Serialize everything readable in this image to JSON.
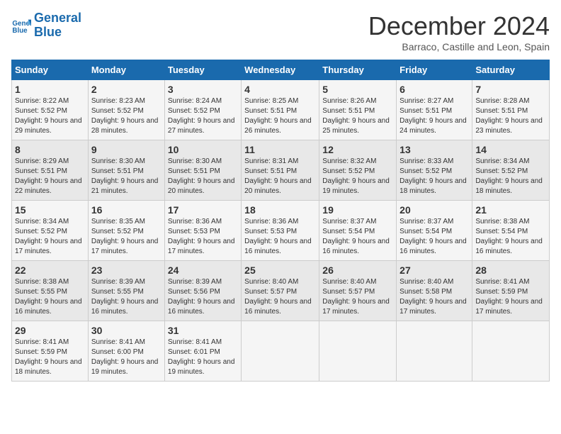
{
  "logo": {
    "line1": "General",
    "line2": "Blue"
  },
  "title": "December 2024",
  "subtitle": "Barraco, Castille and Leon, Spain",
  "days_of_week": [
    "Sunday",
    "Monday",
    "Tuesday",
    "Wednesday",
    "Thursday",
    "Friday",
    "Saturday"
  ],
  "weeks": [
    [
      {
        "day": "1",
        "sunrise": "Sunrise: 8:22 AM",
        "sunset": "Sunset: 5:52 PM",
        "daylight": "Daylight: 9 hours and 29 minutes."
      },
      {
        "day": "2",
        "sunrise": "Sunrise: 8:23 AM",
        "sunset": "Sunset: 5:52 PM",
        "daylight": "Daylight: 9 hours and 28 minutes."
      },
      {
        "day": "3",
        "sunrise": "Sunrise: 8:24 AM",
        "sunset": "Sunset: 5:52 PM",
        "daylight": "Daylight: 9 hours and 27 minutes."
      },
      {
        "day": "4",
        "sunrise": "Sunrise: 8:25 AM",
        "sunset": "Sunset: 5:51 PM",
        "daylight": "Daylight: 9 hours and 26 minutes."
      },
      {
        "day": "5",
        "sunrise": "Sunrise: 8:26 AM",
        "sunset": "Sunset: 5:51 PM",
        "daylight": "Daylight: 9 hours and 25 minutes."
      },
      {
        "day": "6",
        "sunrise": "Sunrise: 8:27 AM",
        "sunset": "Sunset: 5:51 PM",
        "daylight": "Daylight: 9 hours and 24 minutes."
      },
      {
        "day": "7",
        "sunrise": "Sunrise: 8:28 AM",
        "sunset": "Sunset: 5:51 PM",
        "daylight": "Daylight: 9 hours and 23 minutes."
      }
    ],
    [
      {
        "day": "8",
        "sunrise": "Sunrise: 8:29 AM",
        "sunset": "Sunset: 5:51 PM",
        "daylight": "Daylight: 9 hours and 22 minutes."
      },
      {
        "day": "9",
        "sunrise": "Sunrise: 8:30 AM",
        "sunset": "Sunset: 5:51 PM",
        "daylight": "Daylight: 9 hours and 21 minutes."
      },
      {
        "day": "10",
        "sunrise": "Sunrise: 8:30 AM",
        "sunset": "Sunset: 5:51 PM",
        "daylight": "Daylight: 9 hours and 20 minutes."
      },
      {
        "day": "11",
        "sunrise": "Sunrise: 8:31 AM",
        "sunset": "Sunset: 5:51 PM",
        "daylight": "Daylight: 9 hours and 20 minutes."
      },
      {
        "day": "12",
        "sunrise": "Sunrise: 8:32 AM",
        "sunset": "Sunset: 5:52 PM",
        "daylight": "Daylight: 9 hours and 19 minutes."
      },
      {
        "day": "13",
        "sunrise": "Sunrise: 8:33 AM",
        "sunset": "Sunset: 5:52 PM",
        "daylight": "Daylight: 9 hours and 18 minutes."
      },
      {
        "day": "14",
        "sunrise": "Sunrise: 8:34 AM",
        "sunset": "Sunset: 5:52 PM",
        "daylight": "Daylight: 9 hours and 18 minutes."
      }
    ],
    [
      {
        "day": "15",
        "sunrise": "Sunrise: 8:34 AM",
        "sunset": "Sunset: 5:52 PM",
        "daylight": "Daylight: 9 hours and 17 minutes."
      },
      {
        "day": "16",
        "sunrise": "Sunrise: 8:35 AM",
        "sunset": "Sunset: 5:52 PM",
        "daylight": "Daylight: 9 hours and 17 minutes."
      },
      {
        "day": "17",
        "sunrise": "Sunrise: 8:36 AM",
        "sunset": "Sunset: 5:53 PM",
        "daylight": "Daylight: 9 hours and 17 minutes."
      },
      {
        "day": "18",
        "sunrise": "Sunrise: 8:36 AM",
        "sunset": "Sunset: 5:53 PM",
        "daylight": "Daylight: 9 hours and 16 minutes."
      },
      {
        "day": "19",
        "sunrise": "Sunrise: 8:37 AM",
        "sunset": "Sunset: 5:54 PM",
        "daylight": "Daylight: 9 hours and 16 minutes."
      },
      {
        "day": "20",
        "sunrise": "Sunrise: 8:37 AM",
        "sunset": "Sunset: 5:54 PM",
        "daylight": "Daylight: 9 hours and 16 minutes."
      },
      {
        "day": "21",
        "sunrise": "Sunrise: 8:38 AM",
        "sunset": "Sunset: 5:54 PM",
        "daylight": "Daylight: 9 hours and 16 minutes."
      }
    ],
    [
      {
        "day": "22",
        "sunrise": "Sunrise: 8:38 AM",
        "sunset": "Sunset: 5:55 PM",
        "daylight": "Daylight: 9 hours and 16 minutes."
      },
      {
        "day": "23",
        "sunrise": "Sunrise: 8:39 AM",
        "sunset": "Sunset: 5:55 PM",
        "daylight": "Daylight: 9 hours and 16 minutes."
      },
      {
        "day": "24",
        "sunrise": "Sunrise: 8:39 AM",
        "sunset": "Sunset: 5:56 PM",
        "daylight": "Daylight: 9 hours and 16 minutes."
      },
      {
        "day": "25",
        "sunrise": "Sunrise: 8:40 AM",
        "sunset": "Sunset: 5:57 PM",
        "daylight": "Daylight: 9 hours and 16 minutes."
      },
      {
        "day": "26",
        "sunrise": "Sunrise: 8:40 AM",
        "sunset": "Sunset: 5:57 PM",
        "daylight": "Daylight: 9 hours and 17 minutes."
      },
      {
        "day": "27",
        "sunrise": "Sunrise: 8:40 AM",
        "sunset": "Sunset: 5:58 PM",
        "daylight": "Daylight: 9 hours and 17 minutes."
      },
      {
        "day": "28",
        "sunrise": "Sunrise: 8:41 AM",
        "sunset": "Sunset: 5:59 PM",
        "daylight": "Daylight: 9 hours and 17 minutes."
      }
    ],
    [
      {
        "day": "29",
        "sunrise": "Sunrise: 8:41 AM",
        "sunset": "Sunset: 5:59 PM",
        "daylight": "Daylight: 9 hours and 18 minutes."
      },
      {
        "day": "30",
        "sunrise": "Sunrise: 8:41 AM",
        "sunset": "Sunset: 6:00 PM",
        "daylight": "Daylight: 9 hours and 19 minutes."
      },
      {
        "day": "31",
        "sunrise": "Sunrise: 8:41 AM",
        "sunset": "Sunset: 6:01 PM",
        "daylight": "Daylight: 9 hours and 19 minutes."
      },
      null,
      null,
      null,
      null
    ]
  ]
}
